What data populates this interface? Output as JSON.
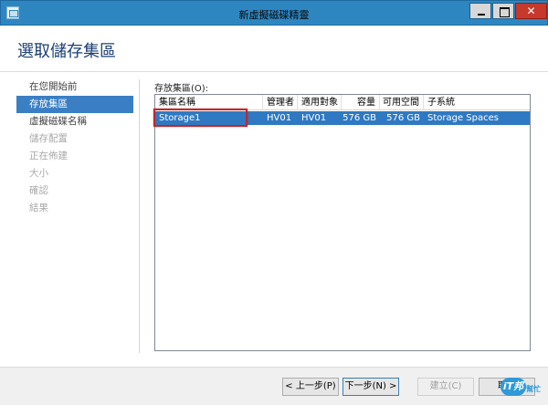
{
  "window": {
    "title": "新虛擬磁碟精靈",
    "close_glyph": "✕"
  },
  "header": {
    "title": "選取儲存集區"
  },
  "nav": {
    "items": [
      {
        "label": "在您開始前",
        "state": "normal"
      },
      {
        "label": "存放集區",
        "state": "active"
      },
      {
        "label": "虛擬磁碟名稱",
        "state": "normal"
      },
      {
        "label": "儲存配置",
        "state": "disabled"
      },
      {
        "label": "正在佈建",
        "state": "disabled"
      },
      {
        "label": "大小",
        "state": "disabled"
      },
      {
        "label": "確認",
        "state": "disabled"
      },
      {
        "label": "結果",
        "state": "disabled"
      }
    ]
  },
  "pools": {
    "label": "存放集區(O):",
    "columns": [
      "集區名稱",
      "管理者",
      "適用對象",
      "容量",
      "可用空間",
      "子系統"
    ],
    "rows": [
      [
        "Storage1",
        "HV01",
        "HV01",
        "576 GB",
        "576 GB",
        "Storage Spaces"
      ]
    ]
  },
  "footer": {
    "prev_label": "< 上一步(P)",
    "next_label": "下一步(N) >",
    "create_label": "建立(C)",
    "cancel_label": "取消"
  },
  "watermark": {
    "logo": "iT邦",
    "text": "幫忙"
  },
  "colors": {
    "titlebar": "#2e86c1",
    "accent": "#3a7fc4",
    "highlight_border": "#c0272d"
  }
}
